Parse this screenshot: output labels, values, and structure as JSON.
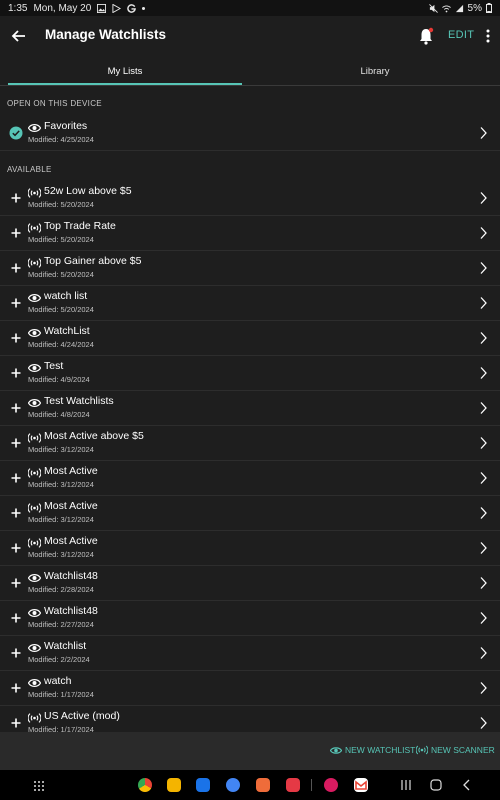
{
  "status_bar": {
    "time": "1:35",
    "date": "Mon, May 20",
    "battery": "5%"
  },
  "header": {
    "title": "Manage Watchlists",
    "edit_label": "EDIT"
  },
  "tabs": [
    {
      "label": "My Lists",
      "selected": true
    },
    {
      "label": "Library",
      "selected": false
    }
  ],
  "sections": {
    "open": "OPEN ON THIS DEVICE",
    "available": "AVAILABLE"
  },
  "open_lists": [
    {
      "name": "Favorites",
      "modified": "Modified: 4/25/2024",
      "kind": "eye-icon",
      "active": true
    }
  ],
  "available_lists": [
    {
      "name": "52w Low above $5",
      "modified": "Modified: 5/20/2024",
      "kind": "scanner-icon"
    },
    {
      "name": "Top Trade Rate",
      "modified": "Modified: 5/20/2024",
      "kind": "scanner-icon"
    },
    {
      "name": "Top Gainer above $5",
      "modified": "Modified: 5/20/2024",
      "kind": "scanner-icon"
    },
    {
      "name": "watch list",
      "modified": "Modified: 5/20/2024",
      "kind": "eye-icon"
    },
    {
      "name": "WatchList",
      "modified": "Modified: 4/24/2024",
      "kind": "eye-icon"
    },
    {
      "name": "Test",
      "modified": "Modified: 4/9/2024",
      "kind": "eye-icon"
    },
    {
      "name": "Test Watchlists",
      "modified": "Modified: 4/8/2024",
      "kind": "eye-icon"
    },
    {
      "name": "Most Active above $5",
      "modified": "Modified: 3/12/2024",
      "kind": "scanner-icon"
    },
    {
      "name": "Most Active",
      "modified": "Modified: 3/12/2024",
      "kind": "scanner-icon"
    },
    {
      "name": "Most Active",
      "modified": "Modified: 3/12/2024",
      "kind": "scanner-icon"
    },
    {
      "name": "Most Active",
      "modified": "Modified: 3/12/2024",
      "kind": "scanner-icon"
    },
    {
      "name": "Watchlist48",
      "modified": "Modified: 2/28/2024",
      "kind": "eye-icon"
    },
    {
      "name": "Watchlist48",
      "modified": "Modified: 2/27/2024",
      "kind": "eye-icon"
    },
    {
      "name": "Watchlist",
      "modified": "Modified: 2/2/2024",
      "kind": "eye-icon"
    },
    {
      "name": "watch",
      "modified": "Modified: 1/17/2024",
      "kind": "eye-icon"
    },
    {
      "name": "US Active (mod)",
      "modified": "Modified: 1/17/2024",
      "kind": "scanner-icon"
    }
  ],
  "bottom_actions": {
    "new_watchlist": "NEW WATCHLIST",
    "new_scanner": "NEW SCANNER"
  },
  "dock_apps": [
    "chrome-icon",
    "files-icon",
    "calendar-icon",
    "messages-icon",
    "contacts-icon",
    "screen-recorder-icon",
    "flower-app-icon",
    "gmail-icon"
  ],
  "colors": {
    "accent": "#57c5b6",
    "background": "#1e1e1e",
    "bottom_bar": "#2a2a2a"
  }
}
